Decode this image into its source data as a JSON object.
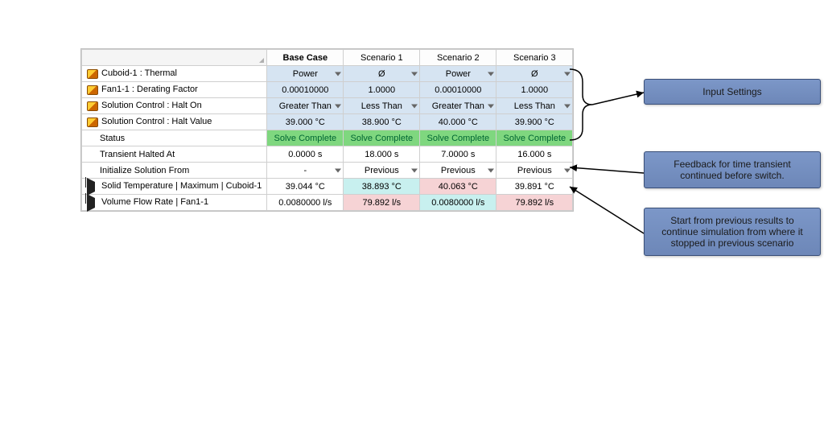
{
  "columns": {
    "corner": "",
    "base": "Base Case",
    "s1": "Scenario 1",
    "s2": "Scenario 2",
    "s3": "Scenario 3"
  },
  "rows": [
    {
      "label": "Cuboid-1 : Thermal",
      "icon": "param",
      "dd": true,
      "cells": [
        "Power",
        "Ø",
        "Power",
        "Ø"
      ],
      "cls": [
        "blue",
        "blue",
        "blue",
        "blue"
      ]
    },
    {
      "label": "Fan1-1 : Derating Factor",
      "icon": "param",
      "dd": false,
      "cells": [
        "0.00010000",
        "1.0000",
        "0.00010000",
        "1.0000"
      ],
      "cls": [
        "blue",
        "blue",
        "blue",
        "blue"
      ]
    },
    {
      "label": "Solution Control : Halt On",
      "icon": "param",
      "dd": true,
      "cells": [
        "Greater Than",
        "Less Than",
        "Greater Than",
        "Less Than"
      ],
      "cls": [
        "blue",
        "blue",
        "blue",
        "blue"
      ]
    },
    {
      "label": "Solution Control : Halt Value",
      "icon": "param",
      "dd": false,
      "cells": [
        "39.000 °C",
        "38.900 °C",
        "40.000 °C",
        "39.900 °C"
      ],
      "cls": [
        "blue",
        "blue",
        "blue",
        "blue"
      ]
    },
    {
      "label": "Status",
      "icon": "",
      "dd": false,
      "indent": true,
      "cells": [
        "Solve Complete",
        "Solve Complete",
        "Solve Complete",
        "Solve Complete"
      ],
      "cls": [
        "green",
        "green",
        "green",
        "green"
      ]
    },
    {
      "label": "Transient Halted At",
      "icon": "",
      "dd": false,
      "indent": true,
      "cells": [
        "0.0000 s",
        "18.000 s",
        "7.0000 s",
        "16.000 s"
      ],
      "cls": [
        "",
        "",
        "",
        ""
      ]
    },
    {
      "label": "Initialize Solution From",
      "icon": "",
      "dd": true,
      "indent": true,
      "cells": [
        "-",
        "Previous",
        "Previous",
        "Previous"
      ],
      "cls": [
        "",
        "",
        "",
        ""
      ]
    },
    {
      "label": "Solid Temperature | Maximum | Cuboid-1",
      "icon": "flag",
      "dd": false,
      "cells": [
        "39.044 °C",
        "38.893 °C",
        "40.063 °C",
        "39.891 °C"
      ],
      "cls": [
        "",
        "lcyan",
        "lpink",
        ""
      ]
    },
    {
      "label": "Volume Flow Rate | Fan1-1",
      "icon": "flag",
      "dd": false,
      "cells": [
        "0.0080000 l/s",
        "79.892 l/s",
        "0.0080000 l/s",
        "79.892 l/s"
      ],
      "cls": [
        "",
        "lpink",
        "lcyan",
        "lpink"
      ]
    }
  ],
  "callouts": {
    "c1": "Input Settings",
    "c2": "Feedback for time transient continued before switch.",
    "c3": "Start from previous results to continue simulation from where it stopped in previous scenario"
  }
}
